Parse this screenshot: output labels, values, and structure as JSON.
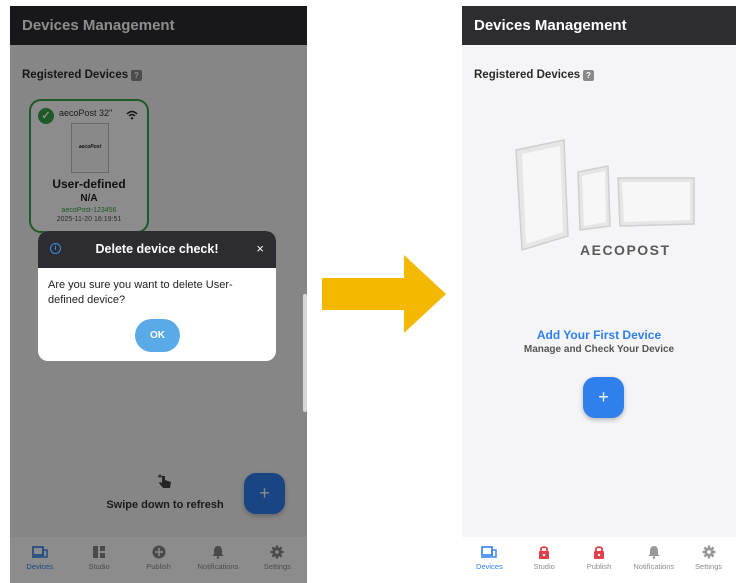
{
  "left_screen": {
    "header_title": "Devices Management",
    "section_title": "Registered Devices",
    "device_card": {
      "name": "aecoPost 32\"",
      "thumbnail_logo": "aecoPost",
      "type": "User-defined",
      "status": "N/A",
      "serial": "aecoPost-123456",
      "date": "2025-11-20 16:19:51"
    },
    "refresh_label": "Swipe down to refresh",
    "fab_label": "+",
    "dialog": {
      "title": "Delete device check!",
      "close": "×",
      "message": "Are you sure you want to delete  User-defined device?",
      "ok_label": "OK"
    },
    "nav": [
      {
        "label": "Devices",
        "icon": "devices-icon"
      },
      {
        "label": "Studio",
        "icon": "studio-icon"
      },
      {
        "label": "Publish",
        "icon": "publish-icon"
      },
      {
        "label": "Notifications",
        "icon": "bell-icon"
      },
      {
        "label": "Settings",
        "icon": "gear-icon"
      }
    ]
  },
  "right_screen": {
    "header_title": "Devices Management",
    "section_title": "Registered Devices",
    "brand_logo": "AECOPOST",
    "empty_title": "Add Your First Device",
    "empty_subtitle": "Manage and Check Your Device",
    "fab_label": "+",
    "nav": [
      {
        "label": "Devices",
        "icon": "devices-icon"
      },
      {
        "label": "Studio",
        "icon": "lock-icon"
      },
      {
        "label": "Publish",
        "icon": "lock-icon"
      },
      {
        "label": "Notifications",
        "icon": "bell-icon"
      },
      {
        "label": "Settings",
        "icon": "gear-icon"
      }
    ]
  },
  "colors": {
    "header_bg": "#2d2d31",
    "accent_blue": "#2f80ed",
    "device_green": "#3aa24a",
    "locked_red": "#e0404a",
    "arrow_yellow": "#f5b800"
  }
}
